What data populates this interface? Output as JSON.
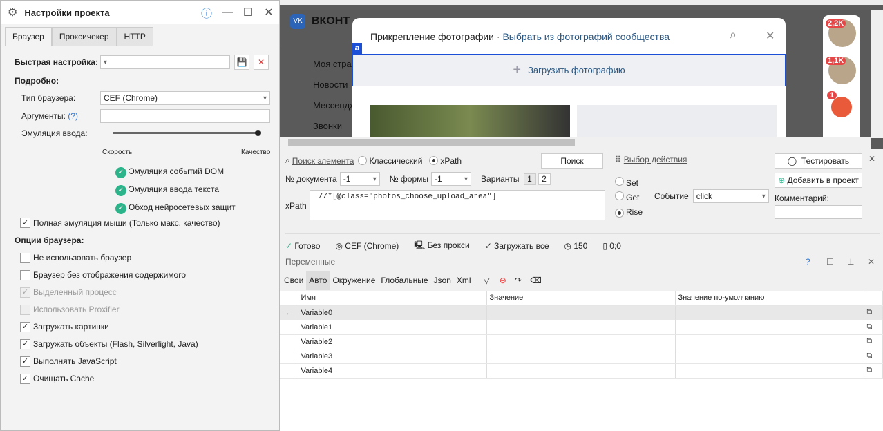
{
  "dialog": {
    "title": "Настройки проекта",
    "tabs": [
      "Браузер",
      "Проксичекер",
      "HTTP"
    ],
    "quick_label": "Быстрая настройка:",
    "detail_label": "Подробно:",
    "browser_type_label": "Тип браузера:",
    "browser_type": "CEF (Chrome)",
    "args_label": "Аргументы:",
    "args_help": "(?)",
    "emulation_label": "Эмуляция ввода:",
    "speed": "Скорость",
    "quality": "Качество",
    "emulation_level": 1.0,
    "features": [
      "Эмуляция событий DOM",
      "Эмуляция ввода текста",
      "Обход нейросетевых защит"
    ],
    "full_mouse": "Полная эмуляция мыши (Только макс. качество)",
    "options_label": "Опции браузера:",
    "options": [
      {
        "label": "Не использовать браузер",
        "checked": false,
        "disabled": false
      },
      {
        "label": "Браузер без отображения содержимого",
        "checked": false,
        "disabled": false
      },
      {
        "label": "Выделенный процесс",
        "checked": true,
        "disabled": true
      },
      {
        "label": "Использовать Proxifier",
        "checked": false,
        "disabled": true
      },
      {
        "label": "Загружать картинки",
        "checked": true,
        "disabled": false
      },
      {
        "label": "Загружать объекты (Flash, Silverlight, Java)",
        "checked": true,
        "disabled": false
      },
      {
        "label": "Выполнять JavaScript",
        "checked": true,
        "disabled": false
      },
      {
        "label": "Очищать Cache",
        "checked": true,
        "disabled": false
      }
    ]
  },
  "vk": {
    "logo": "ВКОНТ",
    "nav": [
      "Моя стра",
      "Новости",
      "Мессендж",
      "Звонки"
    ],
    "modal_title": "Прикрепление фотографии",
    "modal_sep": "·",
    "modal_link": "Выбрать из фотографий сообщества",
    "upload": "Загрузить фотографию",
    "marker": "a",
    "badges": [
      "2,2K",
      "1,1K",
      "1"
    ]
  },
  "search": {
    "find_link": "Поиск элемента",
    "classic": "Классический",
    "xpath_radio": "xPath",
    "search_btn": "Поиск",
    "doc_label": "№ документа",
    "doc_val": "-1",
    "form_label": "№ формы",
    "form_val": "-1",
    "variants_label": "Варианты",
    "variants": [
      "1",
      "2"
    ],
    "xpath_label": "xPath",
    "xpath": "//*[@class=\"photos_choose_upload_area\"]",
    "action_link": "Выбор действия",
    "actions": [
      "Set",
      "Get",
      "Rise"
    ],
    "event_label": "Событие",
    "event": "click",
    "test_btn": "Тестировать",
    "add_btn": "Добавить в проект",
    "comment_label": "Комментарий:"
  },
  "status": [
    "Готово",
    "CEF (Chrome)",
    "Без прокси",
    "Загружать все",
    "150",
    "0;0"
  ],
  "vars": {
    "title": "Переменные",
    "tabs": [
      "Свои",
      "Авто",
      "Окружение",
      "Глобальные",
      "Json",
      "Xml"
    ],
    "columns": [
      "Имя",
      "Значение",
      "Значение по-умолчанию"
    ],
    "rows": [
      "Variable0",
      "Variable1",
      "Variable2",
      "Variable3",
      "Variable4"
    ]
  }
}
